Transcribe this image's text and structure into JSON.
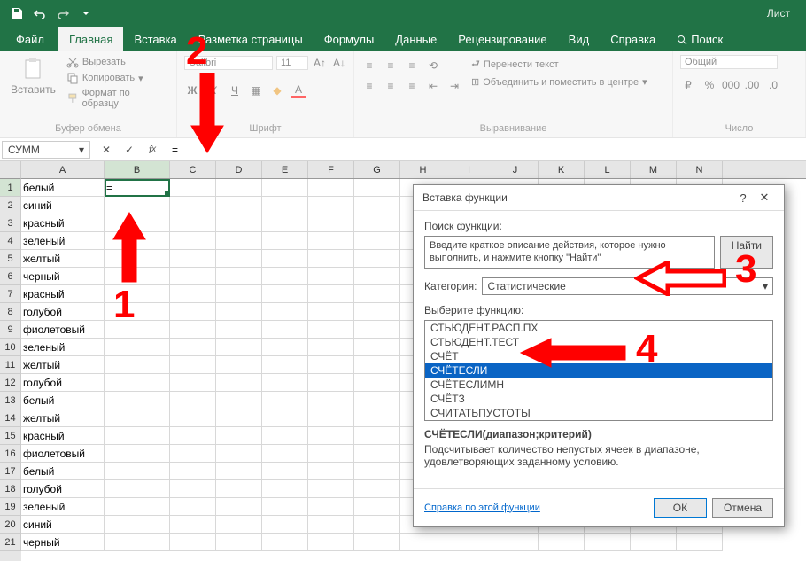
{
  "titlebar": {
    "doc": "Лист"
  },
  "tabs": {
    "file": "Файл",
    "items": [
      "Главная",
      "Вставка",
      "Разметка страницы",
      "Формулы",
      "Данные",
      "Рецензирование",
      "Вид",
      "Справка"
    ],
    "search": "Поиск",
    "active": "Главная"
  },
  "ribbon": {
    "clipboard": {
      "label": "Буфер обмена",
      "paste": "Вставить",
      "cut": "Вырезать",
      "copy": "Копировать",
      "format": "Формат по образцу"
    },
    "font": {
      "label": "Шрифт",
      "name": "Calibri",
      "size": "11"
    },
    "align": {
      "label": "Выравнивание",
      "wrap": "Перенести текст",
      "merge": "Объединить и поместить в центре"
    },
    "number": {
      "label": "Число",
      "format": "Общий"
    }
  },
  "namebox": {
    "ref": "СУММ"
  },
  "formula": {
    "value": "="
  },
  "columns": [
    "A",
    "B",
    "C",
    "D",
    "E",
    "F",
    "G",
    "H",
    "I",
    "J",
    "K",
    "L",
    "M",
    "N"
  ],
  "rows": [
    {
      "a": "белый",
      "b": "="
    },
    {
      "a": "синий"
    },
    {
      "a": "красный"
    },
    {
      "a": "зеленый"
    },
    {
      "a": "желтый"
    },
    {
      "a": "черный"
    },
    {
      "a": "красный"
    },
    {
      "a": "голубой"
    },
    {
      "a": "фиолетовый"
    },
    {
      "a": "зеленый"
    },
    {
      "a": "желтый"
    },
    {
      "a": "голубой"
    },
    {
      "a": "белый"
    },
    {
      "a": "желтый"
    },
    {
      "a": "красный"
    },
    {
      "a": "фиолетовый"
    },
    {
      "a": "белый"
    },
    {
      "a": "голубой"
    },
    {
      "a": "зеленый"
    },
    {
      "a": "синий"
    },
    {
      "a": "черный"
    }
  ],
  "dialog": {
    "title": "Вставка функции",
    "searchLabel": "Поиск функции:",
    "searchPlaceholder": "Введите краткое описание действия, которое нужно выполнить, и нажмите кнопку \"Найти\"",
    "findBtn": "Найти",
    "catLabel": "Категория:",
    "catValue": "Статистические",
    "selectLabel": "Выберите функцию:",
    "functions": [
      "СТЬЮДЕНТ.РАСП.ПХ",
      "СТЬЮДЕНТ.ТЕСТ",
      "СЧЁТ",
      "СЧЁТЕСЛИ",
      "СЧЁТЕСЛИМН",
      "СЧЁТЗ",
      "СЧИТАТЬПУСТОТЫ"
    ],
    "selectedFunc": "СЧЁТЕСЛИ",
    "sig": "СЧЁТЕСЛИ(диапазон;критерий)",
    "desc": "Подсчитывает количество непустых ячеек в диапазоне, удовлетворяющих заданному условию.",
    "helpLink": "Справка по этой функции",
    "ok": "ОК",
    "cancel": "Отмена"
  },
  "annotations": {
    "n1": "1",
    "n2": "2",
    "n3": "3",
    "n4": "4"
  }
}
